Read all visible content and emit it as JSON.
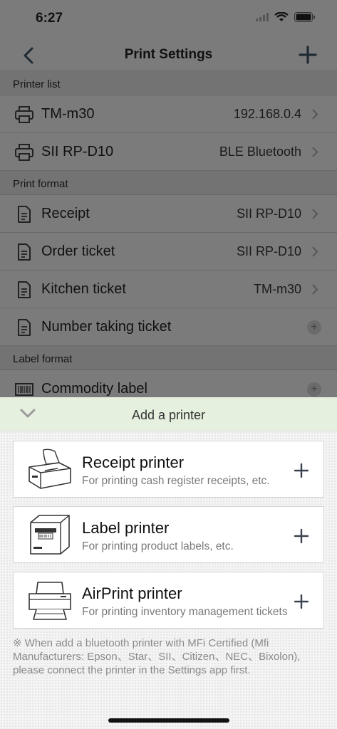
{
  "status_bar": {
    "time": "6:27"
  },
  "nav": {
    "title": "Print Settings"
  },
  "sections": {
    "printer_list": {
      "header": "Printer list",
      "rows": [
        {
          "label": "TM-m30",
          "value": "192.168.0.4"
        },
        {
          "label": "SII RP-D10",
          "value": "BLE Bluetooth"
        }
      ]
    },
    "print_format": {
      "header": "Print format",
      "rows": [
        {
          "label": "Receipt",
          "value": "SII RP-D10"
        },
        {
          "label": "Order ticket",
          "value": "SII RP-D10"
        },
        {
          "label": "Kitchen ticket",
          "value": "TM-m30"
        },
        {
          "label": "Number taking ticket",
          "value": ""
        }
      ]
    },
    "label_format": {
      "header": "Label format",
      "rows": [
        {
          "label": "Commodity label",
          "value": ""
        }
      ]
    }
  },
  "sheet": {
    "title": "Add a printer",
    "cards": [
      {
        "title": "Receipt printer",
        "desc": "For printing cash register receipts, etc."
      },
      {
        "title": "Label printer",
        "desc": "For printing product labels, etc."
      },
      {
        "title": "AirPrint printer",
        "desc": "For printing inventory management tickets"
      }
    ],
    "note": "※ When add a bluetooth printer with MFi Certified (Mfi Manufacturers: Epson、Star、SII、Citizen、NEC、Bixolon), please connect the printer in the Settings app first."
  },
  "icons": {
    "back": "chevron-left-icon",
    "add": "plus-icon",
    "printer": "printer-icon",
    "document": "document-icon",
    "barcode": "barcode-icon",
    "collapse": "chevron-down-icon"
  },
  "colors": {
    "dim_overlay": "#7b7b7b",
    "sheet_header": "#e6f0df",
    "card_plus": "#3a4250"
  }
}
